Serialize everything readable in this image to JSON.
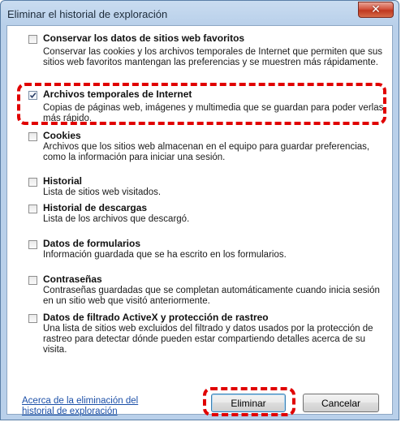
{
  "window": {
    "title": "Eliminar el historial de exploración",
    "close_glyph": "✕"
  },
  "options": [
    {
      "title": "Conservar los datos de sitios web favoritos",
      "checked": false,
      "description": "Conservar las cookies y los archivos temporales de Internet que permiten que sus sitios web favoritos mantengan las preferencias y se muestren más rápidamente."
    },
    {
      "title": "Archivos temporales de Internet",
      "checked": true,
      "description": "Copias de páginas web, imágenes y multimedia que se guardan para poder verlas más rápido."
    },
    {
      "title": "Cookies",
      "checked": false,
      "description": "Archivos que los sitios web almacenan en el equipo para guardar preferencias, como la información para iniciar una sesión."
    },
    {
      "title": "Historial",
      "checked": false,
      "description": "Lista de sitios web visitados."
    },
    {
      "title": "Historial de descargas",
      "checked": false,
      "description": "Lista de los archivos que descargó."
    },
    {
      "title": "Datos de formularios",
      "checked": false,
      "description": "Información guardada que se ha escrito en los formularios."
    },
    {
      "title": "Contraseñas",
      "checked": false,
      "description": "Contraseñas guardadas que se completan automáticamente cuando inicia sesión en un sitio web que visitó anteriormente."
    },
    {
      "title": "Datos de filtrado ActiveX y protección de rastreo",
      "checked": false,
      "description": "Una lista de sitios web excluidos del filtrado y datos usados por la protección de rastreo para detectar dónde pueden estar compartiendo detalles acerca de su visita."
    }
  ],
  "footer": {
    "link_text": "Acerca de la eliminación del historial de exploración",
    "delete_label": "Eliminar",
    "cancel_label": "Cancelar"
  },
  "colors": {
    "highlight": "#e00000",
    "link": "#1b4fa8",
    "close": "#c0381f"
  }
}
